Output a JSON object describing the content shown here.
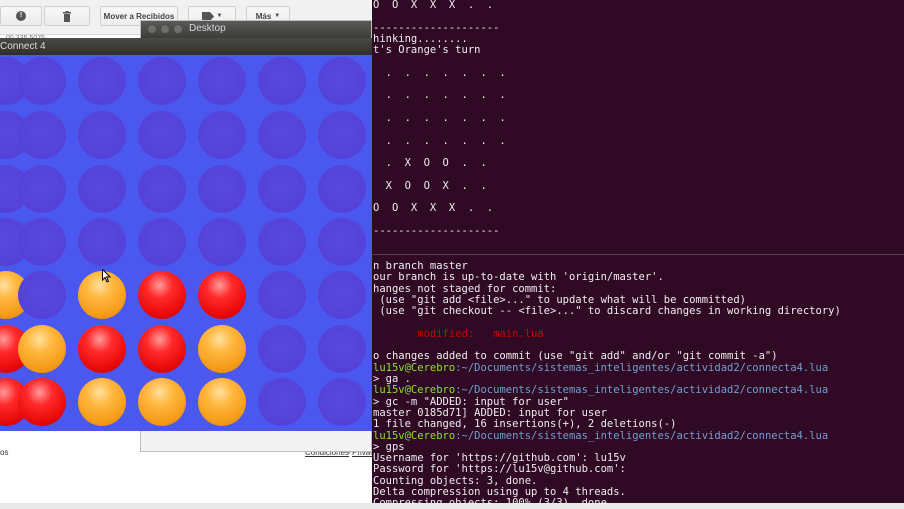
{
  "gmail": {
    "toolbar": {
      "info_icon": "!",
      "move_label": "Mover a Recibidos",
      "more_label": "Más"
    },
    "partial_number": "00 335 5075",
    "footer_left": "os",
    "footer_terms": "Condiciones",
    "footer_sep": "-",
    "footer_privacy": "Privac"
  },
  "desktop_window": {
    "title": "Desktop"
  },
  "connect4": {
    "title": "Connect 4",
    "board": [
      [
        "empty",
        "empty",
        "empty",
        "empty",
        "empty",
        "empty",
        "empty"
      ],
      [
        "empty",
        "empty",
        "empty",
        "empty",
        "empty",
        "empty",
        "empty"
      ],
      [
        "empty",
        "empty",
        "empty",
        "empty",
        "empty",
        "empty",
        "empty"
      ],
      [
        "empty",
        "empty",
        "empty",
        "empty",
        "empty",
        "empty",
        "empty"
      ],
      [
        "orange",
        "empty",
        "orange",
        "red",
        "red",
        "empty",
        "empty"
      ],
      [
        "red",
        "orange",
        "red",
        "red",
        "orange",
        "empty",
        "empty"
      ],
      [
        "red",
        "red",
        "orange",
        "orange",
        "orange",
        "empty",
        "empty"
      ]
    ],
    "colors": {
      "red": "#e80808",
      "orange": "#f59a18",
      "empty": "#5442d8",
      "board": "#4a58f0"
    }
  },
  "terminal": {
    "upper": [
      {
        "text": "O  O  X  X  X  .  ."
      },
      {
        "text": ""
      },
      {
        "text": "--------------------"
      },
      {
        "text": "hinking........"
      },
      {
        "text": "t's Orange's turn"
      },
      {
        "text": ""
      },
      {
        "text": "  .  .  .  .  .  .  ."
      },
      {
        "text": ""
      },
      {
        "text": "  .  .  .  .  .  .  ."
      },
      {
        "text": ""
      },
      {
        "text": "  .  .  .  .  .  .  ."
      },
      {
        "text": ""
      },
      {
        "text": "  .  .  .  .  .  .  ."
      },
      {
        "text": ""
      },
      {
        "text": "  .  X  O  O  .  ."
      },
      {
        "text": ""
      },
      {
        "text": "  X  O  O  X  .  ."
      },
      {
        "text": ""
      },
      {
        "text": "O  O  X  X  X  .  ."
      },
      {
        "text": ""
      },
      {
        "text": "--------------------"
      }
    ],
    "lower": [
      {
        "text": "n branch master"
      },
      {
        "text": "our branch is up-to-date with 'origin/master'."
      },
      {
        "text": "hanges not staged for commit:"
      },
      {
        "text": " (use \"git add <file>...\" to update what will be committed)"
      },
      {
        "text": " (use \"git checkout -- <file>...\" to discard changes in working directory)"
      },
      {
        "text": ""
      },
      {
        "text": "       modified:   main.lua",
        "cls": "red"
      },
      {
        "text": ""
      },
      {
        "text": "o changes added to commit (use \"git add\" and/or \"git commit -a\")"
      },
      {
        "user": "lu15v@Cerebro",
        "path": ":~/Documents/sistemas_inteligentes/actividad2/connecta4.lua"
      },
      {
        "text": "> ga ."
      },
      {
        "user": "lu15v@Cerebro",
        "path": ":~/Documents/sistemas_inteligentes/actividad2/connecta4.lua"
      },
      {
        "text": "> gc -m \"ADDED: input for user\""
      },
      {
        "text": "master 0185d71] ADDED: input for user"
      },
      {
        "text": "1 file changed, 16 insertions(+), 2 deletions(-)"
      },
      {
        "user": "lu15v@Cerebro",
        "path": ":~/Documents/sistemas_inteligentes/actividad2/connecta4.lua"
      },
      {
        "text": "> gps"
      },
      {
        "text": "Username for 'https://github.com': lu15v"
      },
      {
        "text": "Password for 'https://lu15v@github.com':"
      },
      {
        "text": "Counting objects: 3, done."
      },
      {
        "text": "Delta compression using up to 4 threads."
      },
      {
        "text": "Compressing objects: 100% (3/3), done."
      }
    ]
  }
}
